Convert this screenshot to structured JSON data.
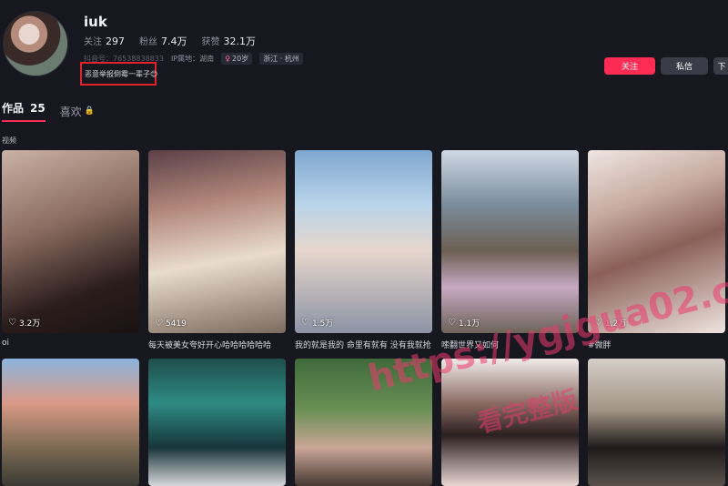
{
  "profile": {
    "username": "iuk",
    "stats": [
      {
        "label": "关注",
        "value": "297"
      },
      {
        "label": "粉丝",
        "value": "7.4万"
      },
      {
        "label": "获赞",
        "value": "32.1万"
      }
    ],
    "account_id": "抖音号：76538838833",
    "ip_location": "IP属地：湖南",
    "age_tag": "20岁",
    "region_tag": "浙江 · 杭州",
    "bio": "恶意举报倒霉一辈子😊"
  },
  "actions": {
    "follow_label": "关注",
    "message_label": "私信",
    "more_label": "下"
  },
  "tabs": [
    {
      "label": "作品",
      "count": "25"
    },
    {
      "label": "喜欢"
    }
  ],
  "section_label": "视频",
  "videos": [
    {
      "likes": "3.2万",
      "caption": "oi"
    },
    {
      "likes": "5419",
      "caption": "每天被美女夸好开心哈哈哈哈哈哈"
    },
    {
      "likes": "1.5万",
      "caption": "我的就是我的 命里有就有 没有我就抢"
    },
    {
      "likes": "1.1万",
      "caption": "嗦翻世界又如何"
    },
    {
      "likes": "1.2万",
      "caption": "#微胖"
    }
  ],
  "watermark": {
    "url": "https://ygjgua02.com",
    "text": "看完整版"
  },
  "colors": {
    "accent": "#fe2c55",
    "background": "#16171f",
    "highlight_box": "#e0232b"
  }
}
